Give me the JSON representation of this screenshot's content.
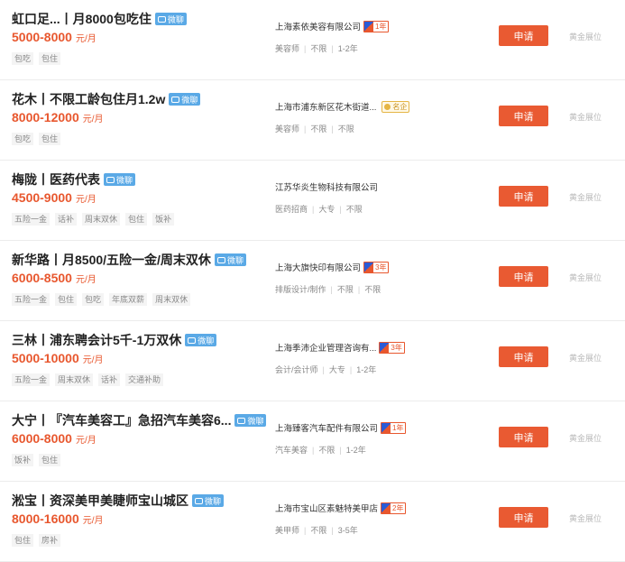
{
  "jobs": [
    {
      "title": "虹口足...丨月8000包吃住",
      "chat": "微聊",
      "salary": "5000-8000",
      "unit": "元/月",
      "tags": [
        "包吃",
        "包住"
      ],
      "company": "上海素依美容有限公司",
      "years": "1年",
      "cert": "",
      "meta": [
        "美容师",
        "不限",
        "1-2年"
      ],
      "apply": "申请",
      "gold": "黄金展位"
    },
    {
      "title": "花木丨不限工龄包住月1.2w",
      "chat": "微聊",
      "salary": "8000-12000",
      "unit": "元/月",
      "tags": [
        "包吃",
        "包住"
      ],
      "company": "上海市浦东新区花木街道...",
      "years": "",
      "cert": "名企",
      "meta": [
        "美容师",
        "不限",
        "不限"
      ],
      "apply": "申请",
      "gold": "黄金展位"
    },
    {
      "title": "梅陇丨医药代表",
      "chat": "微聊",
      "salary": "4500-9000",
      "unit": "元/月",
      "tags": [
        "五险一金",
        "话补",
        "周末双休",
        "包住",
        "饭补"
      ],
      "company": "江苏华炎生物科技有限公司",
      "years": "",
      "cert": "",
      "meta": [
        "医药招商",
        "大专",
        "不限"
      ],
      "apply": "申请",
      "gold": "黄金展位"
    },
    {
      "title": "新华路丨月8500/五险一金/周末双休",
      "chat": "微聊",
      "salary": "6000-8500",
      "unit": "元/月",
      "tags": [
        "五险一金",
        "包住",
        "包吃",
        "年底双薪",
        "周末双休"
      ],
      "company": "上海大旗快印有限公司",
      "years": "3年",
      "cert": "",
      "meta": [
        "排版设计/制作",
        "不限",
        "不限"
      ],
      "apply": "申请",
      "gold": "黄金展位"
    },
    {
      "title": "三林丨浦东聘会计5千-1万双休",
      "chat": "微聊",
      "salary": "5000-10000",
      "unit": "元/月",
      "tags": [
        "五险一金",
        "周末双休",
        "话补",
        "交通补助"
      ],
      "company": "上海季沛企业管理咨询有...",
      "years": "3年",
      "cert": "",
      "meta": [
        "会计/会计师",
        "大专",
        "1-2年"
      ],
      "apply": "申请",
      "gold": "黄金展位"
    },
    {
      "title": "大宁丨『汽车美容工』急招汽车美容6...",
      "chat": "微聊",
      "salary": "6000-8000",
      "unit": "元/月",
      "tags": [
        "饭补",
        "包住"
      ],
      "company": "上海臻客汽车配件有限公司",
      "years": "1年",
      "cert": "",
      "meta": [
        "汽车美容",
        "不限",
        "1-2年"
      ],
      "apply": "申请",
      "gold": "黄金展位"
    },
    {
      "title": "淞宝丨资深美甲美睫师宝山城区",
      "chat": "微聊",
      "salary": "8000-16000",
      "unit": "元/月",
      "tags": [
        "包住",
        "房补"
      ],
      "company": "上海市宝山区素魅特美甲店",
      "years": "2年",
      "cert": "",
      "meta": [
        "美甲师",
        "不限",
        "3-5年"
      ],
      "apply": "申请",
      "gold": "黄金展位"
    }
  ]
}
